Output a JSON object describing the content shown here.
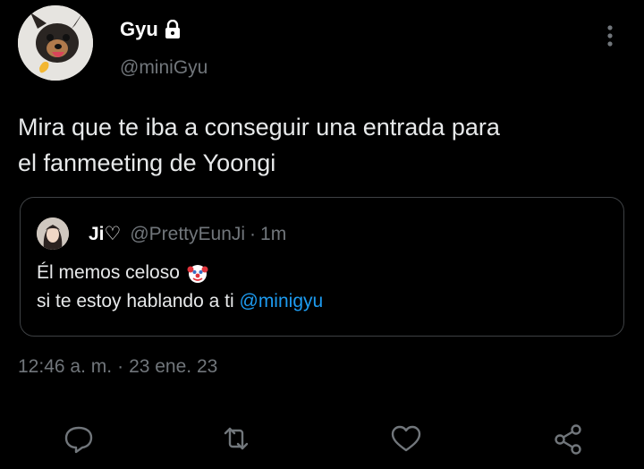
{
  "author": {
    "display_name": "Gyu",
    "handle": "@miniGyu",
    "protected": true
  },
  "tweet": {
    "lines": [
      "Mira que te iba a conseguir una entrada para",
      "el fanmeeting de Yoongi"
    ]
  },
  "quote": {
    "display_name": "Ji♡",
    "handle": "@PrettyEunJi",
    "separator": "·",
    "time": "1m",
    "line1": "Él memos celoso",
    "line2_prefix": "si te estoy hablando a ti",
    "mention": "@minigyu",
    "emoji_icon": "clown-face-icon"
  },
  "timestamp": {
    "time": "12:46 a. m.",
    "separator": "·",
    "date": "23 ene. 23"
  },
  "actions": {
    "icons": [
      "reply-icon",
      "retweet-icon",
      "like-icon",
      "share-icon"
    ]
  },
  "colors": {
    "background": "#000000",
    "text": "#e7e9ea",
    "secondary": "#71767b",
    "link": "#1d9bf0",
    "border": "#3e4144"
  }
}
